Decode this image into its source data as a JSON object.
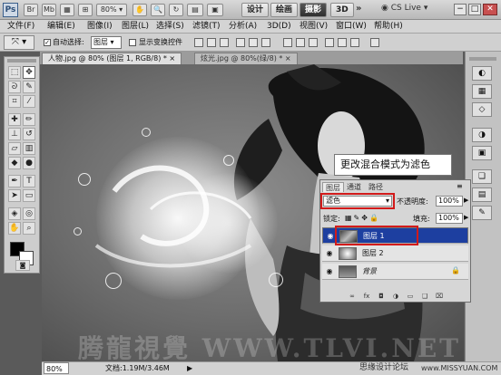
{
  "appbar": {
    "logo": "Ps",
    "icon_br": "Br",
    "icon_mb": "Mb",
    "zoom": "80%",
    "workspaces": [
      "设计",
      "绘画",
      "摄影",
      "3D"
    ],
    "active_workspace": "摄影",
    "more": "»",
    "cslive": "CS Live"
  },
  "menus": [
    "文件(F)",
    "编辑(E)",
    "图像(I)",
    "图层(L)",
    "选择(S)",
    "滤镜(T)",
    "分析(A)",
    "3D(D)",
    "视图(V)",
    "窗口(W)",
    "帮助(H)"
  ],
  "options": {
    "auto_select_label": "自动选择:",
    "auto_select_value": "图层",
    "show_transform_label": "显示变换控件"
  },
  "tabs": [
    {
      "label": "人物.jpg @ 80% (图层 1, RGB/8) *",
      "close": "×"
    },
    {
      "label": "炫光.jpg @ 80%(绿/8) *",
      "close": "×"
    }
  ],
  "callout": "更改混合模式为滤色",
  "layers_panel": {
    "tabs": [
      "图层",
      "通道",
      "路径"
    ],
    "blend_mode": "滤色",
    "opacity_label": "不透明度:",
    "opacity_value": "100%",
    "lock_label": "锁定:",
    "fill_label": "填充:",
    "fill_value": "100%",
    "layers": [
      {
        "name": "图层 1",
        "selected": true
      },
      {
        "name": "图层 2",
        "selected": false
      },
      {
        "name": "背景",
        "selected": false
      }
    ]
  },
  "status": {
    "zoom": "80%",
    "doc": "文档:1.19M/3.46M"
  },
  "watermark": "腾龍視覺 WWW.TLVI.NET",
  "watermark2": "思缘设计论坛",
  "watermark3": "www.MISSYUAN.COM",
  "colors": {
    "accent_selected_layer": "#1d3fa0",
    "highlight_red": "#d21a1a"
  }
}
